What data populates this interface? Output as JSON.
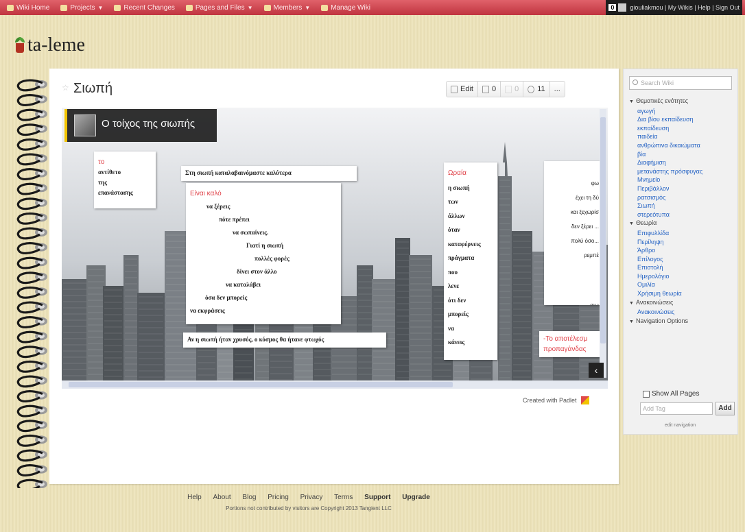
{
  "topbar": {
    "items": [
      {
        "label": "Wiki Home"
      },
      {
        "label": "Projects"
      },
      {
        "label": "Recent Changes"
      },
      {
        "label": "Pages and Files"
      },
      {
        "label": "Members"
      },
      {
        "label": "Manage Wiki"
      }
    ],
    "notification_count": "0",
    "user_links": "giouliakmou | My Wikis | Help | Sign Out"
  },
  "wiki": {
    "title": "ta-leme"
  },
  "page": {
    "title": "Σιωπή",
    "actions": [
      {
        "label": "Edit"
      },
      {
        "label": "0"
      },
      {
        "label": "0"
      },
      {
        "label": "11"
      },
      {
        "label": "..."
      }
    ]
  },
  "padlet": {
    "title": "Ο τοίχος της σιωπής",
    "notes": [
      {
        "lines": [
          "το",
          "αντίθετο",
          "της",
          "επανάστασης"
        ]
      },
      {
        "lines": [
          "Στη σιωπή καταλαβαινόμαστε καλύτερα"
        ]
      },
      {
        "lines": [
          "Είναι καλό",
          "να ξέρεις",
          "πότε πρέπει",
          "να σωπαίνεις.",
          "Γιατί η σιωπή",
          "πολλές φορές",
          "δίνει στον άλλο",
          "να καταλάβει",
          "όσα δεν μπορείς",
          "να εκφράσεις"
        ]
      },
      {
        "lines": [
          "Αν η σιωπή ήταν χρυσός, ο κόσμος θα ήτανε φτωχός"
        ]
      },
      {
        "lines": [
          "Ωραία",
          "η σιωπή",
          "των",
          "άλλων",
          "όταν",
          "καταφέρνεις",
          "πράγματα",
          "που",
          "λενε",
          "ότι δεν",
          "μπορείς",
          "να",
          "κάνεις"
        ]
      },
      {
        "lines": [
          "φω",
          "έχει τη δύ",
          "και ξεχωρίσ",
          "δεν ξέρει ...",
          "πολύ όσο...",
          "ρεμπέ",
          "σιω"
        ]
      },
      {
        "lines": [
          "-Το αποτέλεσμ",
          "προπαγάνδας"
        ]
      }
    ],
    "credit": "Created with Padlet"
  },
  "sidebar": {
    "search_placeholder": "Search Wiki",
    "sections": [
      {
        "title": "Θεματικές ενότητες",
        "links": [
          "αγωγή",
          "Δια βίου εκπαίδευση",
          "εκπαίδευση",
          "παιδεία",
          "ανθρώπινα δικαιώματα",
          "βία",
          "Διαφήμιση",
          "μετανάστης πρόσφυγας",
          "Μνημείο",
          "Περιβάλλον",
          "ρατσισμός",
          "Σιωπή",
          "στερεότυπα"
        ]
      },
      {
        "title": "Θεωρία",
        "links": [
          "Επιφυλλίδα",
          "Περίληψη",
          "Άρθρο",
          "Επίλογος",
          "Επιστολή",
          "Ημερολόγιο",
          "Ομιλία",
          "Χρήσιμη θεωρία"
        ]
      },
      {
        "title": "Ανακοινώσεις",
        "links": [
          "Ανακοινώσεις"
        ]
      },
      {
        "title": "Navigation Options",
        "links": []
      }
    ],
    "show_all_pages": "Show All Pages",
    "add_tag_placeholder": "Add Tag",
    "add_button": "Add",
    "edit_navigation": "edit navigation"
  },
  "footer": {
    "links": [
      "Help",
      "About",
      "Blog",
      "Pricing",
      "Privacy",
      "Terms",
      "Support",
      "Upgrade"
    ],
    "copyright": "Portions not contributed by visitors are Copyright 2013 Tangient LLC"
  },
  "colors": {
    "topbar": "#c94049",
    "accent_red": "#e0434a",
    "link": "#2563c4",
    "background": "#ece2b8"
  }
}
